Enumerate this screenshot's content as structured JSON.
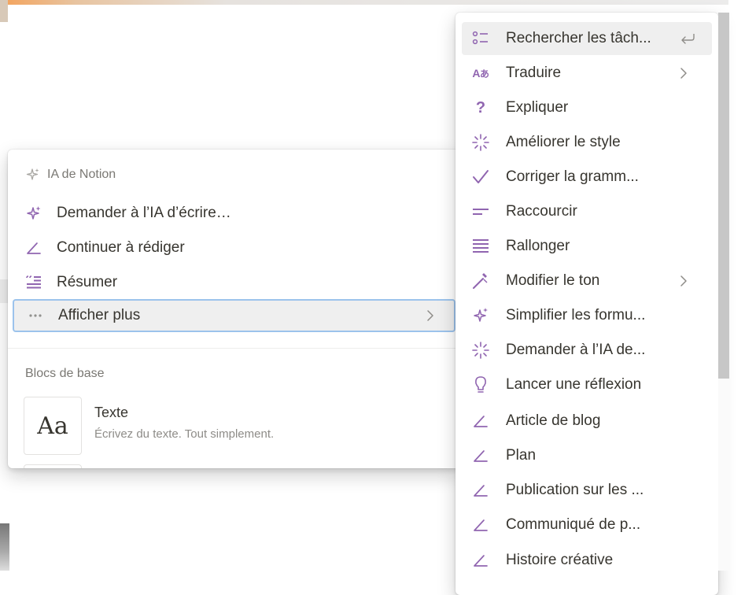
{
  "colors": {
    "ai_purple": "#9065b0",
    "selected_border": "#9cc3ec",
    "selected_bg": "#efefef",
    "muted_text": "#7a7873"
  },
  "main_menu": {
    "ai_section": {
      "header": "IA de Notion",
      "header_icon": "sparkle-icon",
      "items": [
        {
          "label": "Demander à l’IA d’écrire…",
          "icon": "sparkle-icon"
        },
        {
          "label": "Continuer à rédiger",
          "icon": "pen-icon"
        },
        {
          "label": "Résumer",
          "icon": "summary-icon"
        },
        {
          "label": "Afficher plus",
          "icon": "ellipsis-icon",
          "selected": true,
          "has_submenu": true
        }
      ]
    },
    "blocks_section": {
      "header": "Blocs de base",
      "items": [
        {
          "thumb": "Aa",
          "title": "Texte",
          "description": "Écrivez du texte. Tout simplement."
        }
      ]
    }
  },
  "submenu": {
    "items": [
      {
        "label": "Rechercher les tâch...",
        "icon": "checklist-icon",
        "highlighted": true,
        "shortcut_icon": "enter-icon"
      },
      {
        "label": "Traduire",
        "icon": "translate-icon",
        "has_submenu": true
      },
      {
        "label": "Expliquer",
        "icon": "question-icon"
      },
      {
        "label": "Améliorer le style",
        "icon": "magic-burst-icon"
      },
      {
        "label": "Corriger la gramm...",
        "icon": "check-icon"
      },
      {
        "label": "Raccourcir",
        "icon": "shorten-icon"
      },
      {
        "label": "Rallonger",
        "icon": "lengthen-icon"
      },
      {
        "label": "Modifier le ton",
        "icon": "wand-icon",
        "has_submenu": true
      },
      {
        "label": "Simplifier les formu...",
        "icon": "sparkle-icon"
      },
      {
        "label": "Demander à l’IA de...",
        "icon": "magic-burst-icon"
      },
      {
        "label": "Lancer une réflexion",
        "icon": "lightbulb-icon"
      },
      {
        "label": "Article de blog",
        "icon": "pen-icon"
      },
      {
        "label": "Plan",
        "icon": "pen-icon"
      },
      {
        "label": "Publication sur les ...",
        "icon": "pen-icon"
      },
      {
        "label": "Communiqué de p...",
        "icon": "pen-icon"
      },
      {
        "label": "Histoire créative",
        "icon": "pen-icon"
      }
    ]
  }
}
